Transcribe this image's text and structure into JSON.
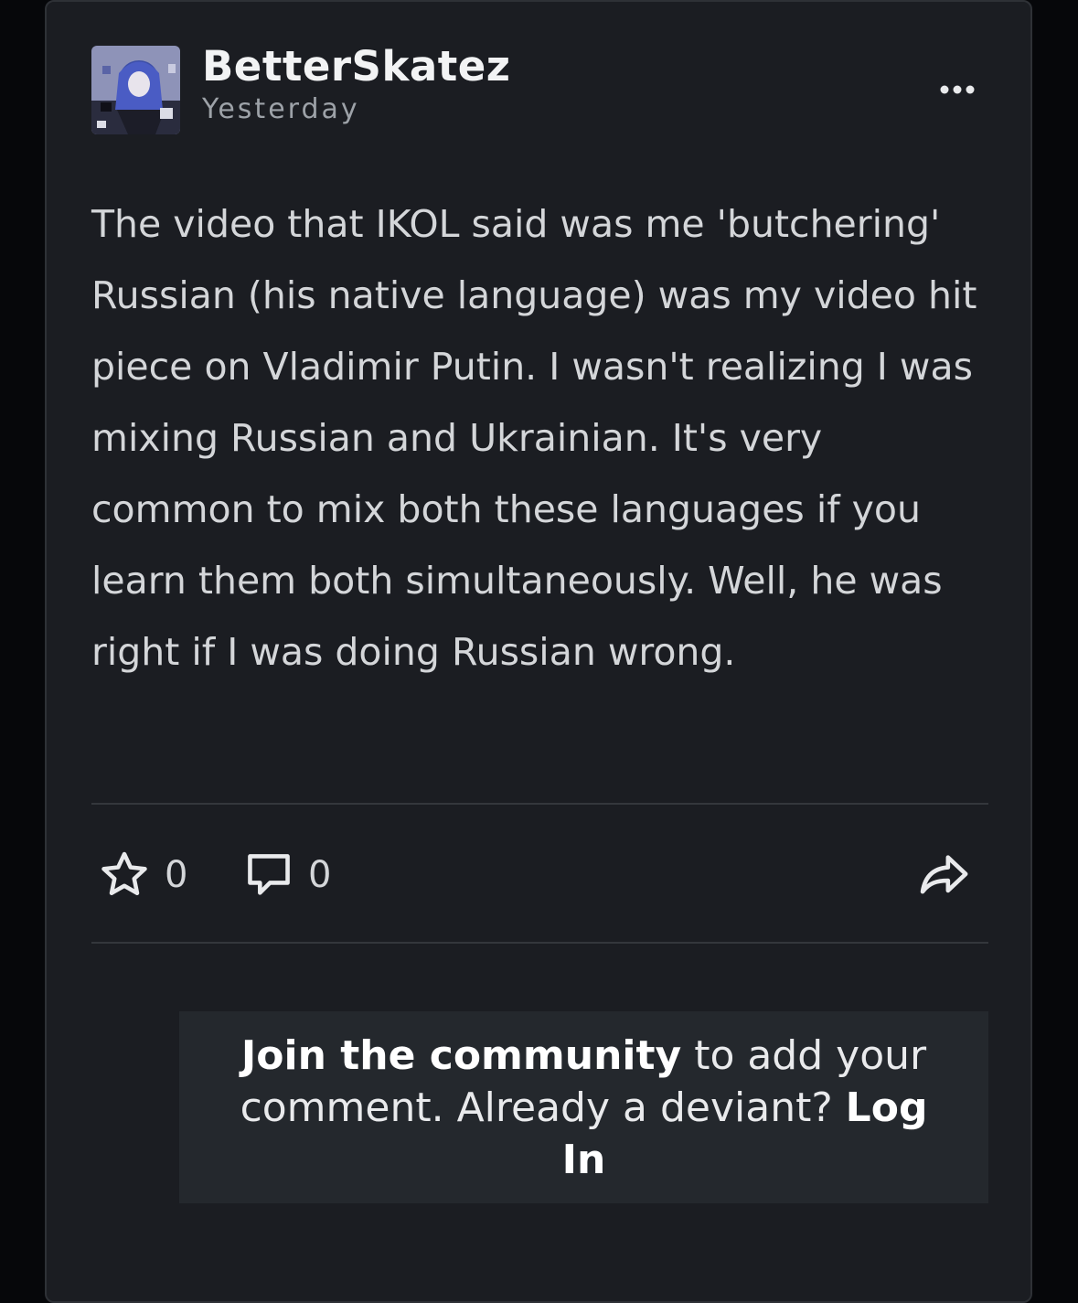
{
  "post": {
    "username": "BetterSkatez",
    "timestamp": "Yesterday",
    "avatar_icon": "anime-character-avatar",
    "more_icon": "more-options-icon",
    "body": "The video that IKOL said was me 'butchering' Russian (his native language) was my video hit piece on Vladimir Putin. I wasn't realizing I was mixing Russian and Ukrainian. It's very common to mix both these languages if you learn them both simultaneously. Well, he was right if I was doing Russian wrong."
  },
  "actions": {
    "favourite_count": "0",
    "comment_count": "0",
    "favourite_icon": "star-icon",
    "comment_icon": "comment-bubble-icon",
    "share_icon": "share-arrow-icon"
  },
  "join": {
    "join_link": "Join the community",
    "text_middle": " to add your comment. Already a deviant? ",
    "login_link": "Log In"
  },
  "colors": {
    "background": "#06070a",
    "card": "#1b1d22",
    "join_box": "#24282d",
    "text": "#d4d6d9",
    "muted": "#9da2a8"
  }
}
